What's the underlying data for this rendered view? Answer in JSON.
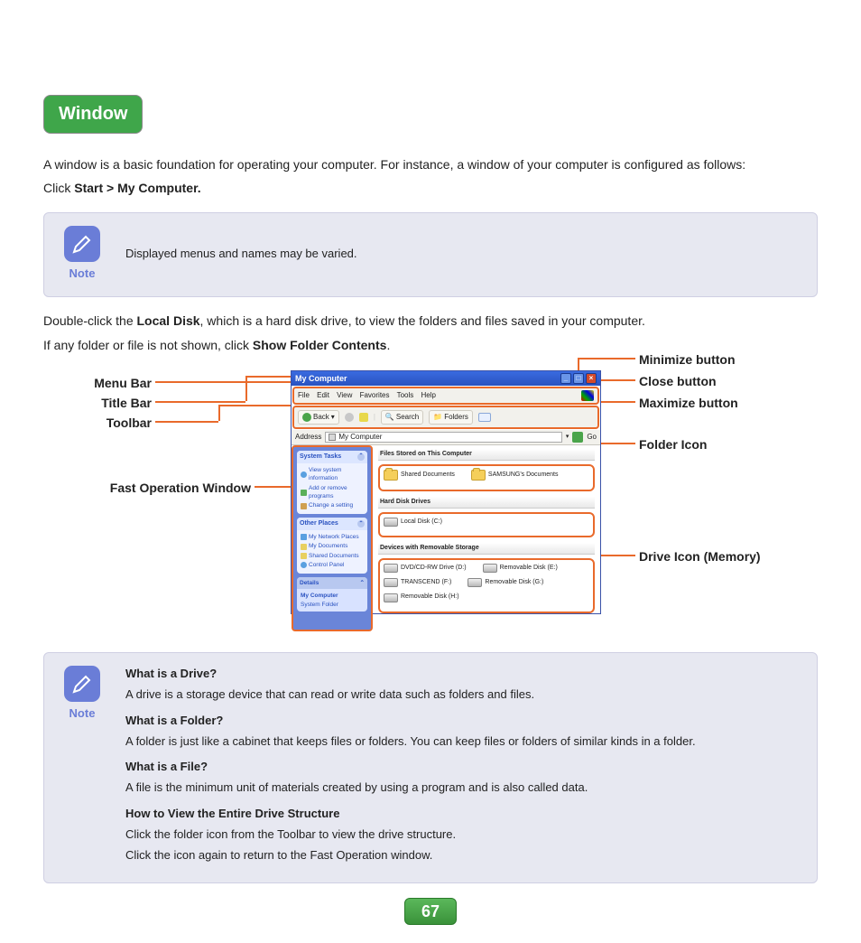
{
  "heading": "Window",
  "intro": "A window is a basic foundation for operating your computer. For instance, a window of your computer is configured as follows:",
  "click_prefix": "Click ",
  "click_path": "Start > My Computer.",
  "note1": {
    "label": "Note",
    "text": "Displayed menus and names may be varied."
  },
  "para2_pre": "Double-click the ",
  "para2_bold": "Local Disk",
  "para2_post": ", which is a hard disk drive, to view the folders and files saved in your computer.",
  "para3_pre": "If any folder or file is not shown, click ",
  "para3_bold": "Show Folder Contents",
  "para3_post": ".",
  "callouts": {
    "left": [
      "Menu Bar",
      "Title Bar",
      "Toolbar",
      "Fast Operation Window"
    ],
    "right": [
      "Minimize button",
      "Close button",
      "Maximize button",
      "Folder Icon",
      "Drive Icon (Memory)"
    ]
  },
  "window": {
    "title": "My Computer",
    "menu": [
      "File",
      "Edit",
      "View",
      "Favorites",
      "Tools",
      "Help"
    ],
    "toolbar": {
      "back": "Back",
      "search": "Search",
      "folders": "Folders"
    },
    "address_label": "Address",
    "address_value": "My Computer",
    "go": "Go",
    "sidebar": {
      "system_tasks": {
        "head": "System Tasks",
        "items": [
          "View system information",
          "Add or remove programs",
          "Change a setting"
        ]
      },
      "other_places": {
        "head": "Other Places",
        "items": [
          "My Network Places",
          "My Documents",
          "Shared Documents",
          "Control Panel"
        ]
      },
      "details": {
        "head": "Details",
        "l1": "My Computer",
        "l2": "System Folder"
      }
    },
    "content": {
      "sec1": "Files Stored on This Computer",
      "folders": [
        "Shared Documents",
        "SAMSUNG's Documents"
      ],
      "sec2": "Hard Disk Drives",
      "hdds": [
        "Local Disk (C:)"
      ],
      "sec3": "Devices with Removable Storage",
      "dev_row1": [
        "DVD/CD-RW Drive (D:)",
        "Removable Disk (E:)"
      ],
      "dev_row2": [
        "TRANSCEND (F:)",
        "Removable Disk (G:)"
      ],
      "dev_row3": [
        "Removable Disk (H:)"
      ]
    }
  },
  "note2": {
    "label": "Note",
    "q1": "What is a Drive?",
    "a1": "A drive is a storage device that can read or write data such as folders and files.",
    "q2": "What is a Folder?",
    "a2": "A folder is just like a cabinet that keeps files or folders. You can keep files or folders of similar kinds in a folder.",
    "q3": "What is a File?",
    "a3": "A file is the minimum unit of materials created by using a program and is also called data.",
    "q4": "How to View the Entire Drive Structure",
    "a4a": "Click the folder icon from the Toolbar to view the drive structure.",
    "a4b": "Click the icon again to return to the Fast Operation window."
  },
  "page_number": "67"
}
